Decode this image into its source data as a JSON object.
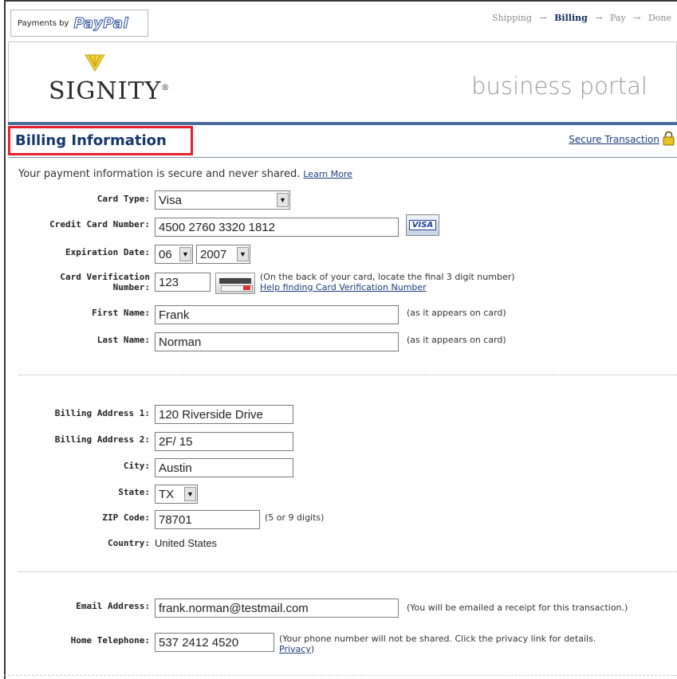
{
  "header": {
    "payments_by": "Payments by",
    "paypal_logo": "PayPal",
    "steps": [
      "Shipping",
      "Billing",
      "Pay",
      "Done"
    ],
    "active_step": "Billing",
    "arrow": "→"
  },
  "banner": {
    "logo": "SIGNITY",
    "logo_mark": "®",
    "portal": "business portal"
  },
  "section": {
    "title": "Billing Information",
    "secure_link": "Secure Transaction",
    "intro": "Your payment information is secure and never shared.",
    "learn_more": "Learn More"
  },
  "card": {
    "type_label": "Card Type:",
    "type_value": "Visa",
    "number_label": "Credit Card Number:",
    "number_value": "4500 2760 3320 1812",
    "visa_badge": "VISA",
    "exp_label": "Expiration Date:",
    "exp_month": "06",
    "exp_year": "2007",
    "cvn_label_1": "Card Verification",
    "cvn_label_2": "Number:",
    "cvn_value": "123",
    "cvn_hint": "(On the back of your card, locate the final 3 digit number)",
    "cvn_help": "Help finding Card Verification Number"
  },
  "name": {
    "first_label": "First Name:",
    "first_value": "Frank",
    "first_hint": "(as it appears on card)",
    "last_label": "Last Name:",
    "last_value": "Norman",
    "last_hint": "(as it appears on card)"
  },
  "address": {
    "addr1_label": "Billing Address 1:",
    "addr1_value": "120 Riverside Drive",
    "addr2_label": "Billing Address 2:",
    "addr2_value": "2F/ 15",
    "city_label": "City:",
    "city_value": "Austin",
    "state_label": "State:",
    "state_value": "TX",
    "zip_label": "ZIP Code:",
    "zip_value": "78701",
    "zip_hint": "(5 or 9 digits)",
    "country_label": "Country:",
    "country_value": "United States"
  },
  "contact": {
    "email_label": "Email Address:",
    "email_value": "frank.norman@testmail.com",
    "email_hint": "(You will be emailed a receipt for this transaction.)",
    "phone_label": "Home Telephone:",
    "phone_value": "537 2412 4520",
    "phone_hint": "(Your phone number will not be shared. Click the privacy link for details.",
    "privacy_link": "Privacy",
    "privacy_tail": ")"
  },
  "colors": {
    "title_blue": "#14386b",
    "highlight_red": "#e2212b",
    "link_blue": "#1a3d7c",
    "rule_blue": "#4b6b9b"
  }
}
